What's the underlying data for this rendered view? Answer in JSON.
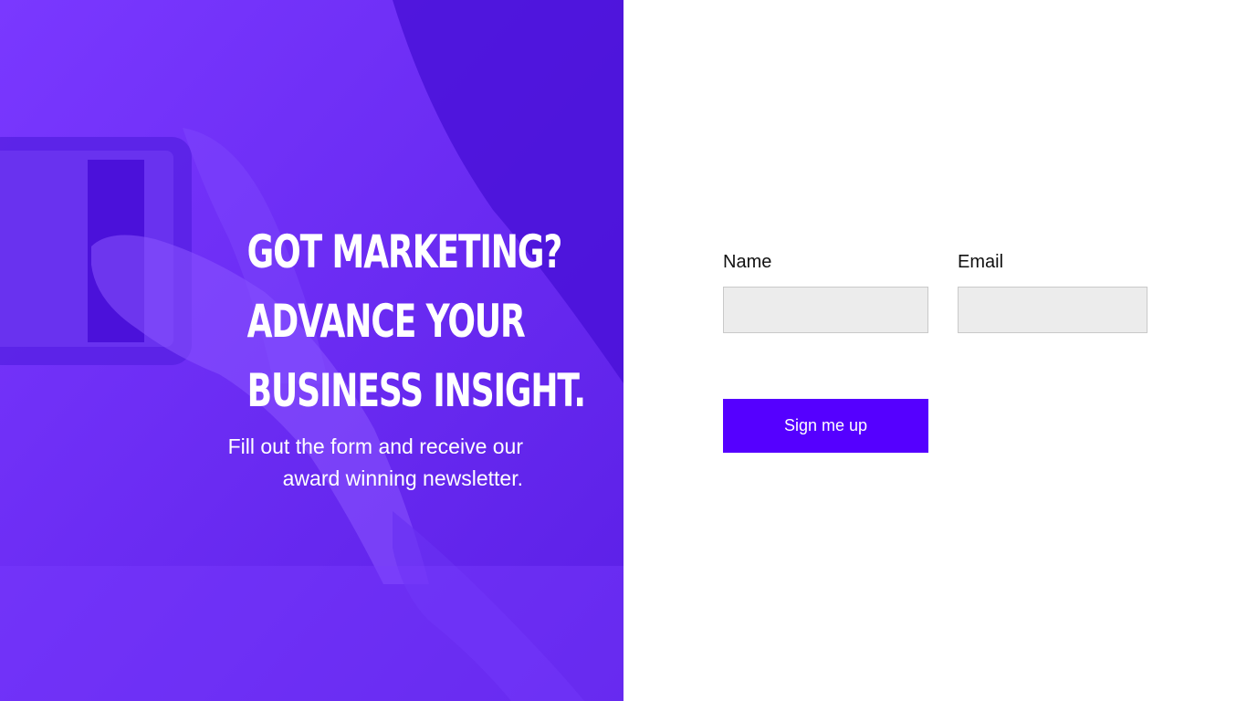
{
  "hero": {
    "headline_lines": [
      "Got Marketing?",
      "Advance Your",
      "Business Insight."
    ],
    "subtext_lines": [
      "Fill out the form and receive our",
      "award winning newsletter."
    ],
    "overlay_color": "#6c2cf6"
  },
  "form": {
    "name_label": "Name",
    "name_value": "",
    "email_label": "Email",
    "email_value": "",
    "submit_label": "Sign me up",
    "button_color": "#5500ff"
  }
}
